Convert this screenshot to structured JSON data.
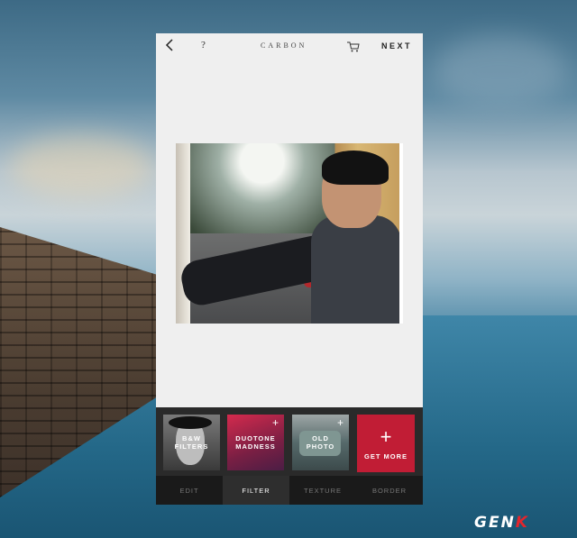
{
  "topbar": {
    "back_icon": "chevron-left-icon",
    "help_label": "?",
    "title": "CARBON",
    "cart_icon": "cart-icon",
    "next_label": "NEXT"
  },
  "filters": [
    {
      "label": "B&W\nFILTERS",
      "has_plus": false
    },
    {
      "label": "DUOTONE\nMADNESS",
      "has_plus": true
    },
    {
      "label": "OLD\nPHOTO",
      "has_plus": true
    },
    {
      "label": "GET MORE",
      "icon": "plus-icon"
    }
  ],
  "tabs": [
    {
      "label": "EDIT",
      "active": false
    },
    {
      "label": "FILTER",
      "active": true
    },
    {
      "label": "TEXTURE",
      "active": false
    },
    {
      "label": "BORDER",
      "active": false
    }
  ],
  "watermark": {
    "main": "GEN",
    "accent": "K"
  },
  "colors": {
    "accent": "#c11d35",
    "panel": "#2a2a2a",
    "tabs_bg": "#1a1a1a",
    "app_bg": "#efefef"
  }
}
